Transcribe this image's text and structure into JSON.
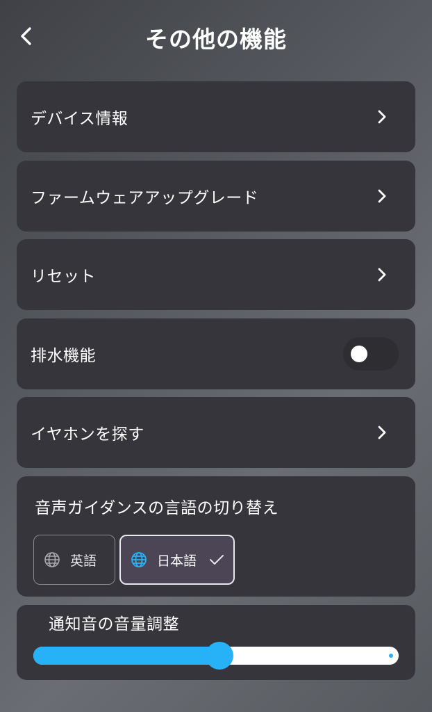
{
  "header": {
    "title": "その他の機能",
    "back_icon": "chevron-left-icon"
  },
  "menu": {
    "device_info": "デバイス情報",
    "firmware_upgrade": "ファームウェアアップグレード",
    "reset": "リセット",
    "drainage": "排水機能",
    "drainage_enabled": false,
    "find_earphones": "イヤホンを探す"
  },
  "voice_guidance": {
    "title": "音声ガイダンスの言語の切り替え",
    "languages": [
      {
        "label": "英語",
        "selected": false,
        "icon": "globe-icon"
      },
      {
        "label": "日本語",
        "selected": true,
        "icon": "globe-icon"
      }
    ]
  },
  "notification_volume": {
    "title": "通知音の音量調整",
    "level": 0.51
  },
  "colors": {
    "accent": "#27b1f7",
    "card": "#35353b",
    "selected_language_bg": "#4b4556"
  }
}
